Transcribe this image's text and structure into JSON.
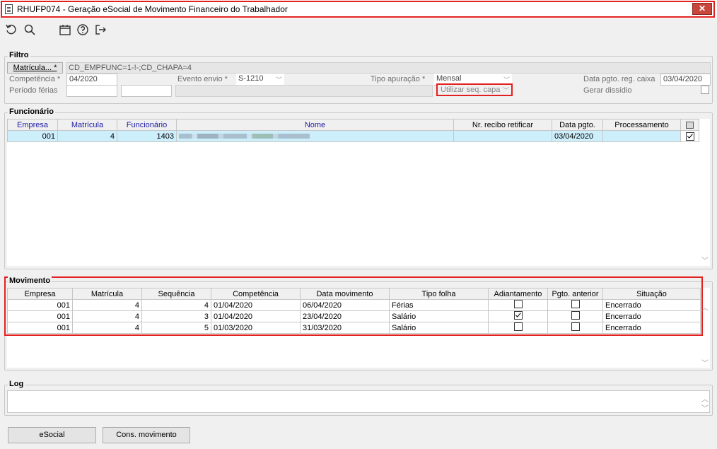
{
  "window": {
    "title": "RHUFP074 - Geração eSocial de Movimento Financeiro do Trabalhador",
    "close_glyph": "✕"
  },
  "toolbar": {
    "icons": [
      "undo-icon",
      "search-icon",
      "calendar-icon",
      "help-icon",
      "exit-icon"
    ]
  },
  "filtro": {
    "title": "Filtro",
    "matricula_button": "Matrícula... *",
    "matricula_value": "CD_EMPFUNC=1-!-;CD_CHAPA=4",
    "competencia_label": "Competência *",
    "competencia_value": "04/2020",
    "evento_label": "Evento envio *",
    "evento_value": "S-1210",
    "tipo_apuracao_label": "Tipo apuração *",
    "tipo_apuracao_value": "Mensal",
    "data_pgto_label": "Data pgto. reg. caixa",
    "data_pgto_value": "03/04/2020",
    "periodo_ferias_label": "Período férias",
    "periodo_ferias_start": "",
    "periodo_ferias_end": "",
    "utilizar_seq_capa": "Utilizar seq. capa",
    "gerar_dissidio_label": "Gerar dissídio"
  },
  "funcionario": {
    "title": "Funcionário",
    "columns": [
      "Empresa",
      "Matrícula",
      "Funcionário",
      "Nome",
      "Nr. recibo retificar",
      "Data pgto.",
      "Processamento"
    ],
    "rows": [
      {
        "empresa": "001",
        "matricula": "4",
        "funcionario": "1403",
        "nome": "",
        "recibo": "",
        "data_pgto": "03/04/2020",
        "processamento": "",
        "checked": true
      }
    ]
  },
  "movimento": {
    "title": "Movimento",
    "columns": [
      "Empresa",
      "Matrícula",
      "Sequência",
      "Competência",
      "Data movimento",
      "Tipo folha",
      "Adiantamento",
      "Pgto. anterior",
      "Situação"
    ],
    "rows": [
      {
        "empresa": "001",
        "matricula": "4",
        "sequencia": "4",
        "competencia": "01/04/2020",
        "data_movimento": "06/04/2020",
        "tipo_folha": "Férias",
        "adiantamento": false,
        "pgto_anterior": false,
        "situacao": "Encerrado"
      },
      {
        "empresa": "001",
        "matricula": "4",
        "sequencia": "3",
        "competencia": "01/04/2020",
        "data_movimento": "23/04/2020",
        "tipo_folha": "Salário",
        "adiantamento": true,
        "pgto_anterior": false,
        "situacao": "Encerrado"
      },
      {
        "empresa": "001",
        "matricula": "4",
        "sequencia": "5",
        "competencia": "01/03/2020",
        "data_movimento": "31/03/2020",
        "tipo_folha": "Salário",
        "adiantamento": false,
        "pgto_anterior": false,
        "situacao": "Encerrado"
      }
    ]
  },
  "log": {
    "title": "Log",
    "value": ""
  },
  "buttons": {
    "esocial": "eSocial",
    "cons_movimento": "Cons. movimento"
  },
  "colors": {
    "highlight_red": "#e32020",
    "selected_row": "#cdeffb",
    "header_blue": "#1c1aa4"
  }
}
